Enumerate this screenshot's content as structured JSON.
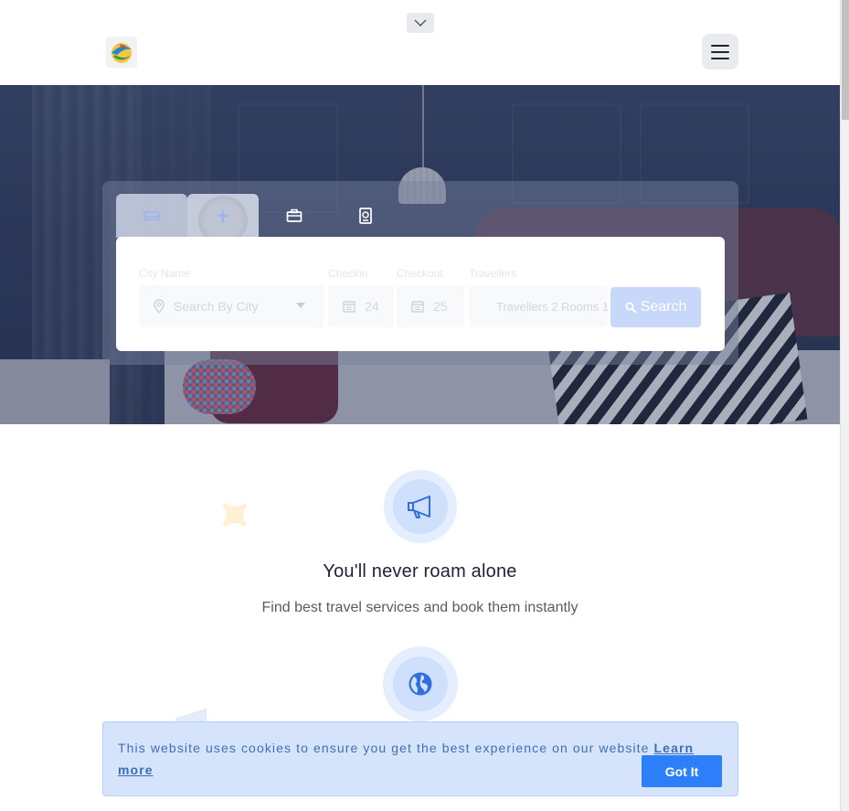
{
  "header": {
    "logo_icon": "travel-globe-logo",
    "menu_icon": "hamburger-icon",
    "collapse_icon": "chevron-down-icon"
  },
  "search": {
    "tabs": [
      {
        "name": "hotels",
        "icon": "bed-icon"
      },
      {
        "name": "flights",
        "icon": "airplane-icon"
      },
      {
        "name": "tours",
        "icon": "briefcase-icon"
      },
      {
        "name": "visa",
        "icon": "passport-icon"
      }
    ],
    "fields": {
      "city_label": "City Name",
      "city_placeholder": "Search By City",
      "checkin_label": "Checkin",
      "checkin_value": "24",
      "checkout_label": "Checkout",
      "checkout_value": "25",
      "travellers_label": "Travellers",
      "travellers_value": "Travellers 2 Rooms 1"
    },
    "button_label": "Search"
  },
  "feature": {
    "title": "You'll never roam alone",
    "subtitle": "Find best travel services and book them instantly"
  },
  "cookie": {
    "message": "This website uses cookies to ensure you get the best experience on our website",
    "link_label": "Learn more",
    "button_label": "Got It"
  },
  "colors": {
    "accent": "#2d7ff9",
    "search_button": "#c8d8fb",
    "cookie_bg": "#d6e4fb",
    "feature_icon": "#2f6fe0"
  }
}
